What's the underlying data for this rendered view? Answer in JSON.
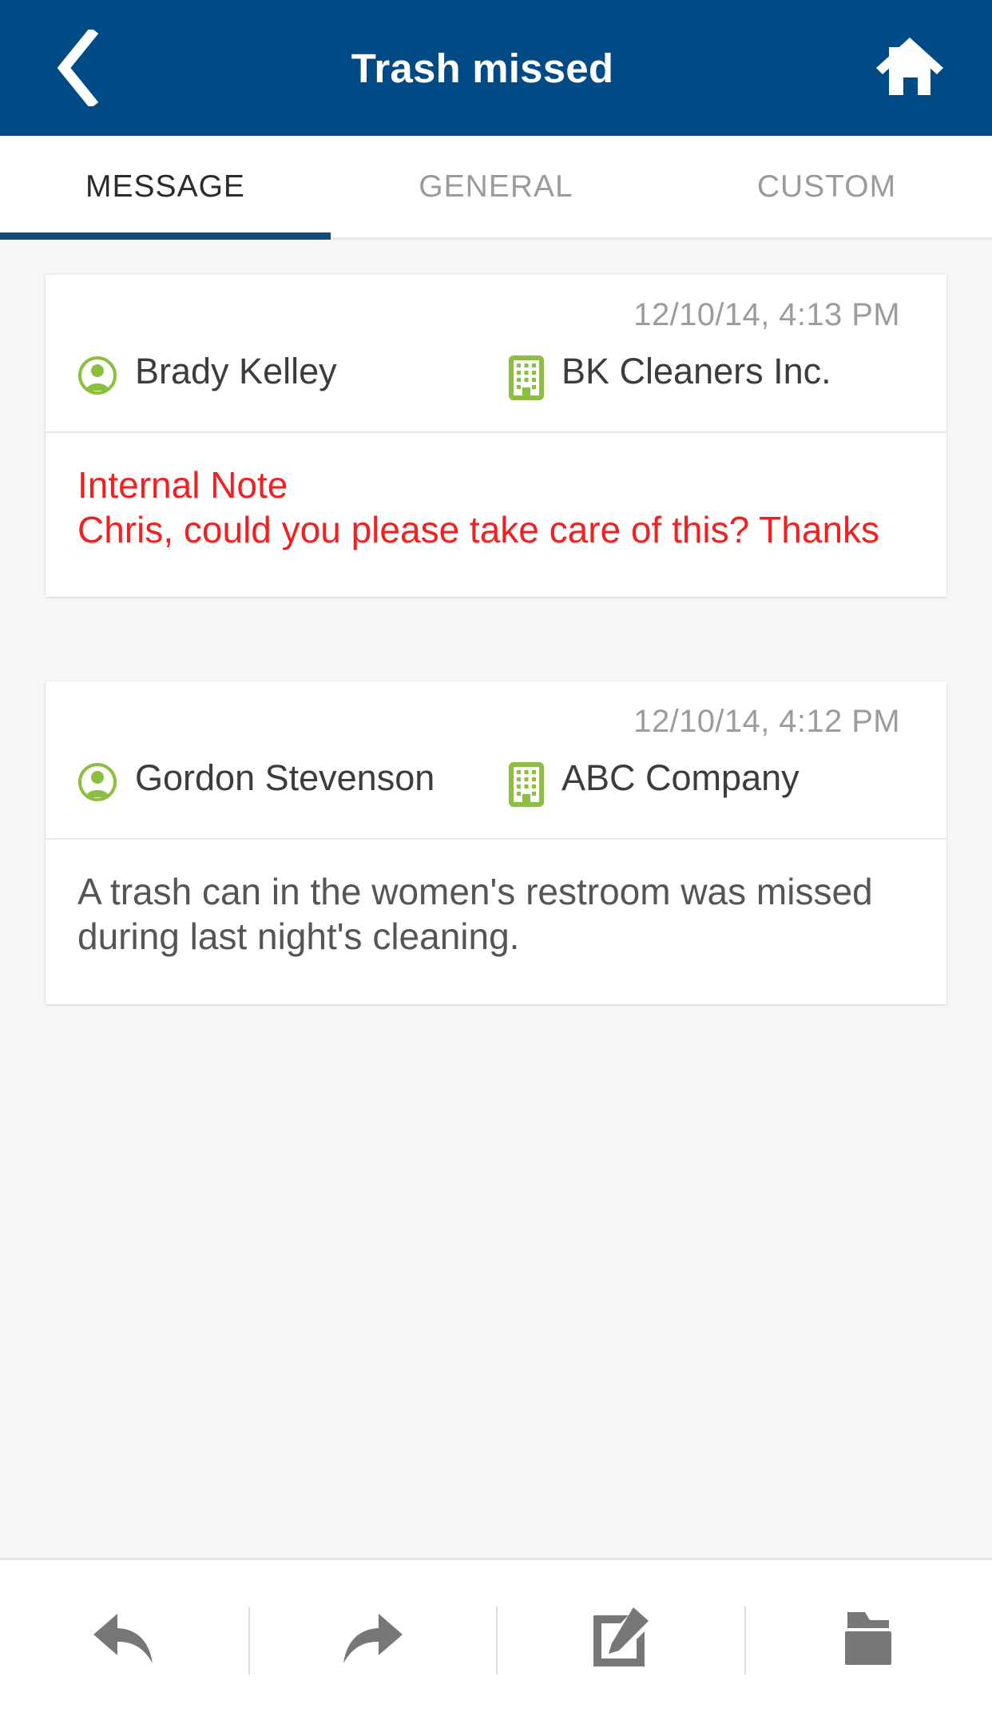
{
  "header": {
    "title": "Trash missed",
    "back_icon": "chevron-left-icon",
    "home_icon": "home-icon",
    "background_color": "#004B85"
  },
  "tabs": [
    {
      "label": "MESSAGE",
      "active": true
    },
    {
      "label": "GENERAL",
      "active": false
    },
    {
      "label": "CUSTOM",
      "active": false
    }
  ],
  "messages": [
    {
      "timestamp": "12/10/14, 4:13 PM",
      "person": "Brady Kelley",
      "person_icon": "user-circle-icon",
      "company": "BK Cleaners Inc.",
      "company_icon": "building-icon",
      "body": "Internal Note\nChris, could you please take care of this? Thanks",
      "body_style": "internal-note",
      "body_color": "#f41f1f"
    },
    {
      "timestamp": "12/10/14, 4:12 PM",
      "person": "Gordon Stevenson",
      "person_icon": "user-circle-icon",
      "company": "ABC Company",
      "company_icon": "building-icon",
      "body": "A trash can in the women's restroom was missed during last night's cleaning.",
      "body_style": "normal",
      "body_color": "#555555"
    }
  ],
  "toolbar": [
    {
      "name": "reply",
      "icon": "reply-arrow-icon"
    },
    {
      "name": "forward",
      "icon": "forward-arrow-icon"
    },
    {
      "name": "compose",
      "icon": "compose-edit-icon"
    },
    {
      "name": "folder",
      "icon": "folder-icon"
    }
  ],
  "colors": {
    "accent_green": "#8CBE3F",
    "header_blue": "#004B85",
    "tab_underline": "#144B7F",
    "internal_red": "#f41f1f",
    "body_gray": "#555555"
  }
}
